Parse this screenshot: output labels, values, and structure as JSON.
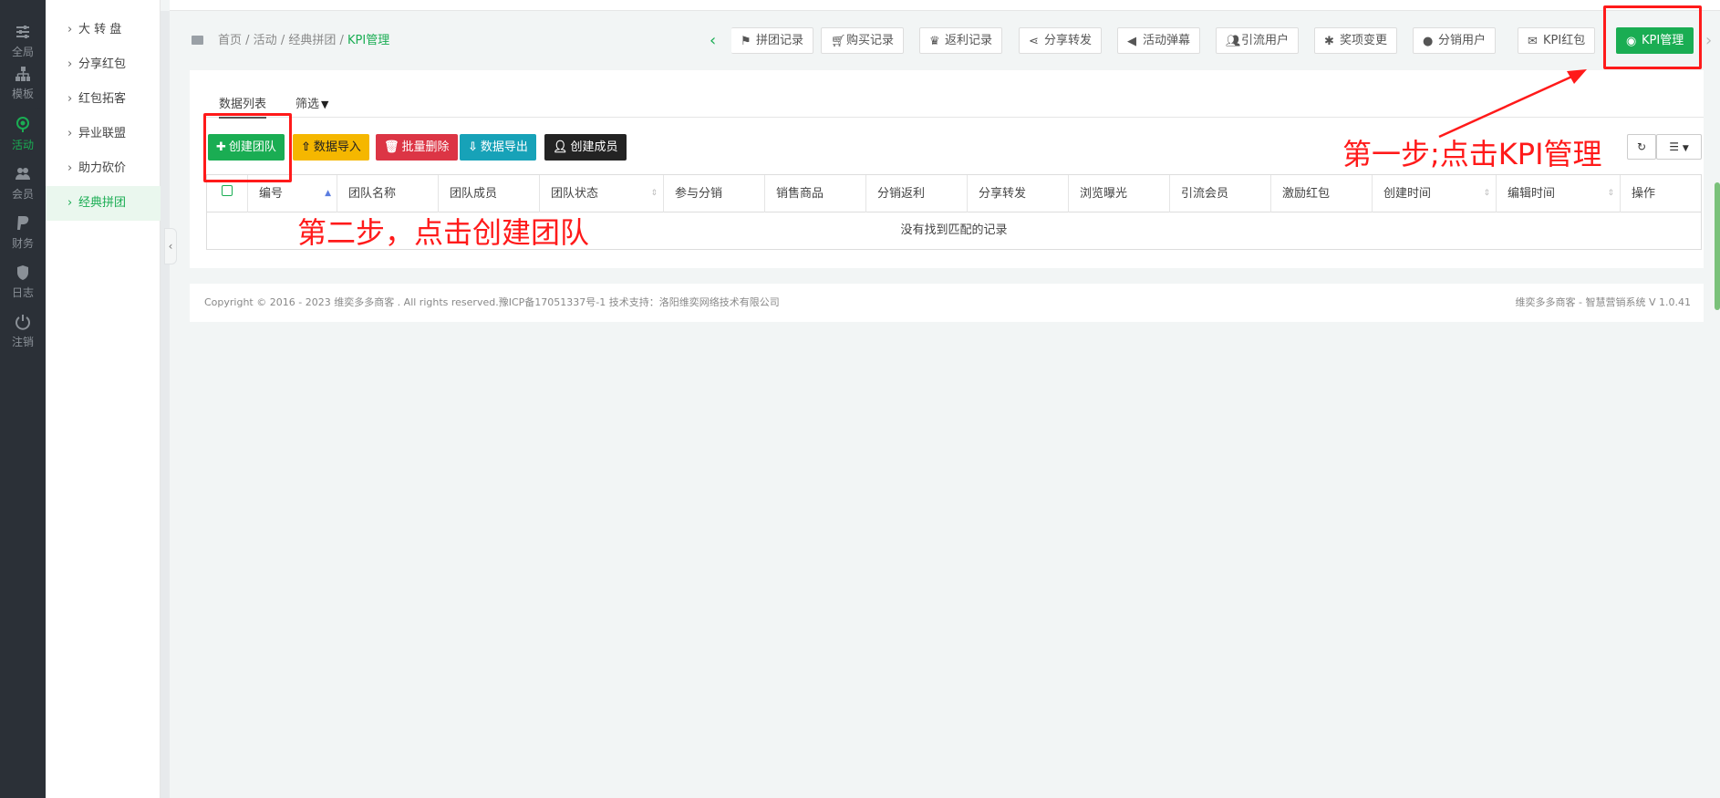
{
  "rail": {
    "items": [
      {
        "label": "全局",
        "icon": "sliders-icon"
      },
      {
        "label": "模板",
        "icon": "sitemap-icon"
      },
      {
        "label": "活动",
        "icon": "location-icon",
        "active": true
      },
      {
        "label": "会员",
        "icon": "users-icon"
      },
      {
        "label": "财务",
        "icon": "paypal-icon"
      },
      {
        "label": "日志",
        "icon": "shield-icon"
      },
      {
        "label": "注销",
        "icon": "power-icon"
      }
    ]
  },
  "submenu": {
    "items": [
      {
        "label": "大 转 盘"
      },
      {
        "label": "分享红包"
      },
      {
        "label": "红包拓客"
      },
      {
        "label": "异业联盟"
      },
      {
        "label": "助力砍价"
      },
      {
        "label": "经典拼团",
        "active": true
      }
    ]
  },
  "breadcrumb": {
    "home": "首页",
    "sep1": " / ",
    "level1": "活动",
    "sep2": " / ",
    "level2": "经典拼团",
    "sep3": " / ",
    "current": "KPI管理"
  },
  "tabs": [
    {
      "label": "拼团记录",
      "icon": "flag-icon"
    },
    {
      "label": "购买记录",
      "icon": "cart-icon"
    },
    {
      "label": "返利记录",
      "icon": "trophy-icon"
    },
    {
      "label": "分享转发",
      "icon": "share-icon"
    },
    {
      "label": "活动弹幕",
      "icon": "bullhorn-icon"
    },
    {
      "label": "引流用户",
      "icon": "users-icon"
    },
    {
      "label": "奖项变更",
      "icon": "bug-icon"
    },
    {
      "label": "分销用户",
      "icon": "user-icon"
    },
    {
      "label": "KPI红包",
      "icon": "envelope-icon"
    },
    {
      "label": "KPI管理",
      "icon": "circle-dot-icon",
      "active": true
    }
  ],
  "panel": {
    "tab_list": "数据列表",
    "tab_filter": "筛选"
  },
  "actions": {
    "create_team": "创建团队",
    "import": "数据导入",
    "batch_delete": "批量删除",
    "export": "数据导出",
    "create_member": "创建成员"
  },
  "table": {
    "columns": [
      "编号",
      "团队名称",
      "团队成员",
      "团队状态",
      "参与分销",
      "销售商品",
      "分销返利",
      "分享转发",
      "浏览曝光",
      "引流会员",
      "激励红包",
      "创建时间",
      "编辑时间",
      "操作"
    ],
    "empty_text": "没有找到匹配的记录"
  },
  "footer": {
    "left": "Copyright © 2016 - 2023 维奕多多商客 . All rights reserved.豫ICP备17051337号-1 技术支持：洛阳维奕网络技术有限公司",
    "right": "维奕多多商客 - 智慧营销系统 V 1.0.41"
  },
  "annotations": {
    "step1": "第一步;点击KPI管理",
    "step2": "第二步，点击创建团队"
  },
  "colors": {
    "accent": "#1aad53",
    "annotation": "#ff1a1a"
  }
}
